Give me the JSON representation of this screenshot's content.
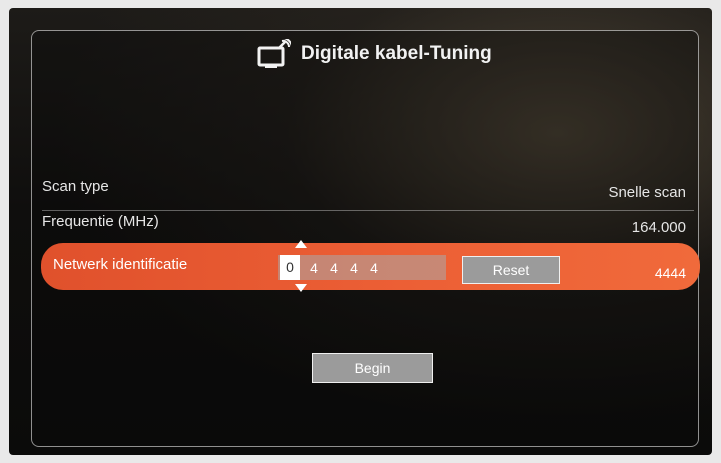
{
  "dialog": {
    "title": "Digitale kabel-Tuning",
    "icon": "tv-antenna-icon"
  },
  "rows": [
    {
      "label": "Scan type",
      "value": "Snelle scan"
    },
    {
      "label": "Frequentie (MHz)",
      "value": "164.000"
    }
  ],
  "network": {
    "label": "Netwerk identificatie",
    "digits": [
      "0",
      "4",
      "4",
      "4",
      "4"
    ],
    "active_digit": 0,
    "value": "4444",
    "reset_label": "Reset"
  },
  "begin_label": "Begin",
  "colors": {
    "highlight": "#ec5f35",
    "button": "#9b9b9b",
    "text": "#e6e6e6"
  }
}
